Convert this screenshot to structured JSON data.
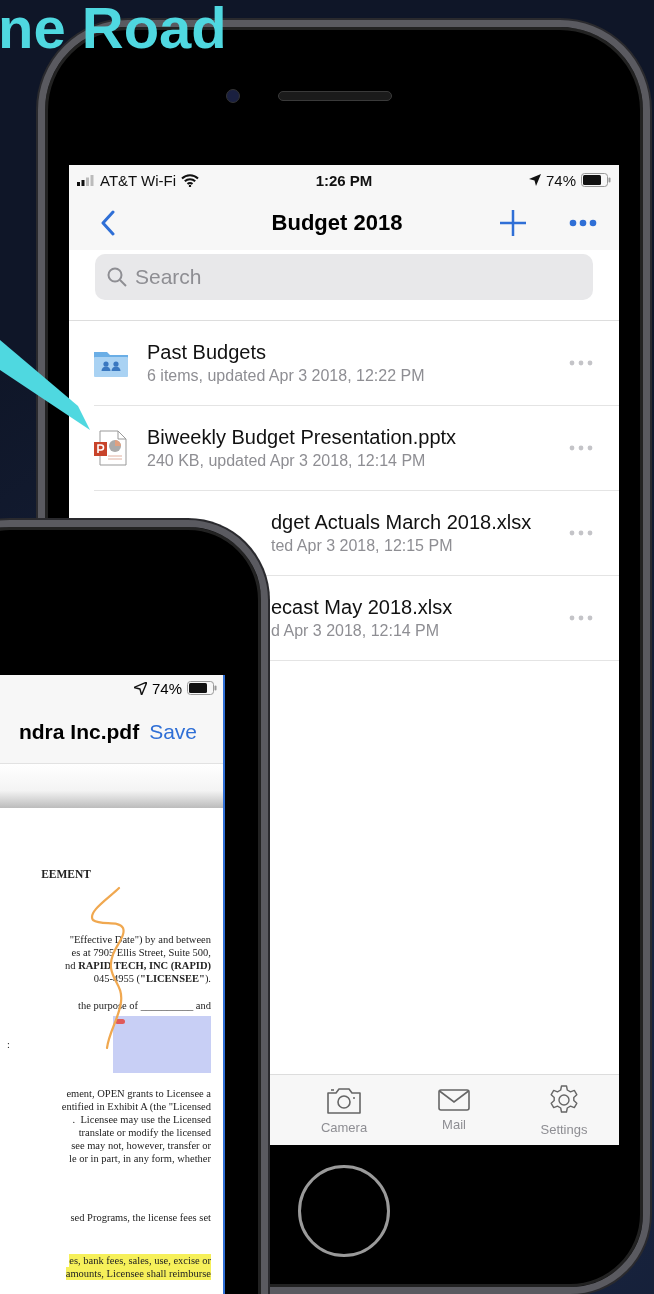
{
  "headline": "ne Road",
  "back_phone": {
    "status_bar": {
      "carrier": "AT&T Wi-Fi",
      "time": "1:26 PM",
      "battery": "74%"
    },
    "nav": {
      "title": "Budget 2018"
    },
    "search": {
      "placeholder": "Search"
    },
    "files": [
      {
        "kind": "folder",
        "name": "Past Budgets",
        "details": "6 items, updated Apr 3 2018, 12:22 PM"
      },
      {
        "kind": "pptx",
        "name": "Biweekly Budget Presentation.pptx",
        "details": "240 KB, updated Apr 3 2018, 12:14 PM"
      },
      {
        "kind": "xlsx",
        "name": "dget Actuals March 2018.xlsx",
        "details": "ted Apr 3 2018, 12:15 PM"
      },
      {
        "kind": "xlsx",
        "name": "ecast May 2018.xlsx",
        "details": "d Apr 3 2018, 12:14 PM"
      }
    ],
    "tab_bar": [
      {
        "kind": "camera",
        "label": "Camera"
      },
      {
        "kind": "mail",
        "label": "Mail"
      },
      {
        "kind": "settings",
        "label": "Settings"
      }
    ]
  },
  "front_phone": {
    "status_bar": {
      "battery": "74%"
    },
    "nav": {
      "title": "ndra Inc.pdf",
      "action": "Save"
    },
    "document": {
      "paragraphs": [
        {
          "kind": "heading",
          "lines": [
            "EEMENT"
          ]
        },
        {
          "kind": "plain",
          "lines": [
            "\"Effective Date\") by and between",
            "es at 7905 Ellis Street, Suite 500,",
            "nd **RAPID TECH, INC (RAPID)**",
            "045-4955 (**\"LICENSEE\"**)."
          ]
        },
        {
          "kind": "plain",
          "lines": [
            "the purpose of __________ and"
          ]
        },
        {
          "kind": "label",
          "lines": [
            ":"
          ]
        },
        {
          "kind": "plain",
          "lines": [
            "ement, OPEN grants to Licensee a",
            "entified in Exhibit A (the \"Licensed",
            ".  Licensee may use the Licensed",
            "translate or modify the licensed",
            "see may not, however, transfer or",
            "le or in part, in any form, whether"
          ]
        },
        {
          "kind": "plain",
          "lines": [
            "sed Programs, the license fees set"
          ]
        },
        {
          "kind": "highlighted",
          "lines": [
            "es, bank fees, sales, use, excise or",
            "amounts, Licensee shall reimburse"
          ]
        }
      ]
    }
  }
}
